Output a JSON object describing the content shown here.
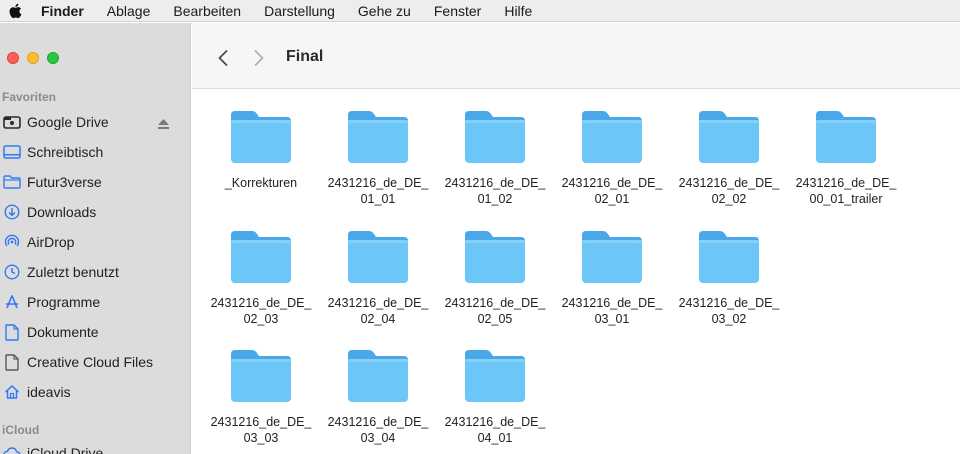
{
  "menubar": {
    "items": [
      "Finder",
      "Ablage",
      "Bearbeiten",
      "Darstellung",
      "Gehe zu",
      "Fenster",
      "Hilfe"
    ]
  },
  "sidebar": {
    "favorites_title": "Favoriten",
    "items": [
      {
        "label": "Google Drive",
        "icon": "drive-icon"
      },
      {
        "label": "Schreibtisch",
        "icon": "desktop-icon"
      },
      {
        "label": "Futur3verse",
        "icon": "folder-icon"
      },
      {
        "label": "Downloads",
        "icon": "download-icon"
      },
      {
        "label": "AirDrop",
        "icon": "airdrop-icon"
      },
      {
        "label": "Zuletzt benutzt",
        "icon": "clock-icon"
      },
      {
        "label": "Programme",
        "icon": "apps-icon"
      },
      {
        "label": "Dokumente",
        "icon": "document-icon"
      },
      {
        "label": "Creative Cloud Files",
        "icon": "file-icon"
      },
      {
        "label": "ideavis",
        "icon": "home-icon"
      }
    ],
    "icloud_title": "iCloud",
    "icloud_items": [
      {
        "label": "iCloud Drive",
        "icon": "cloud-icon"
      }
    ]
  },
  "toolbar": {
    "title": "Final"
  },
  "folders": [
    {
      "line1": "_Korrekturen",
      "line2": ""
    },
    {
      "line1": "2431216_de_DE_",
      "line2": "01_01"
    },
    {
      "line1": "2431216_de_DE_",
      "line2": "01_02"
    },
    {
      "line1": "2431216_de_DE_",
      "line2": "02_01"
    },
    {
      "line1": "2431216_de_DE_",
      "line2": "02_02"
    },
    {
      "line1": "2431216_de_DE_",
      "line2": "00_01_trailer"
    },
    {
      "line1": "2431216_de_DE_",
      "line2": "02_03"
    },
    {
      "line1": "2431216_de_DE_",
      "line2": "02_04"
    },
    {
      "line1": "2431216_de_DE_",
      "line2": "02_05"
    },
    {
      "line1": "2431216_de_DE_",
      "line2": "03_01"
    },
    {
      "line1": "2431216_de_DE_",
      "line2": "03_02"
    },
    {
      "line1": "2431216_de_DE_",
      "line2": "03_03"
    },
    {
      "line1": "2431216_de_DE_",
      "line2": "03_04"
    },
    {
      "line1": "2431216_de_DE_",
      "line2": "04_01"
    }
  ],
  "colors": {
    "accent": "#3478f6",
    "folder_body": "#6cc6f8",
    "folder_tab": "#4aa8e8"
  }
}
